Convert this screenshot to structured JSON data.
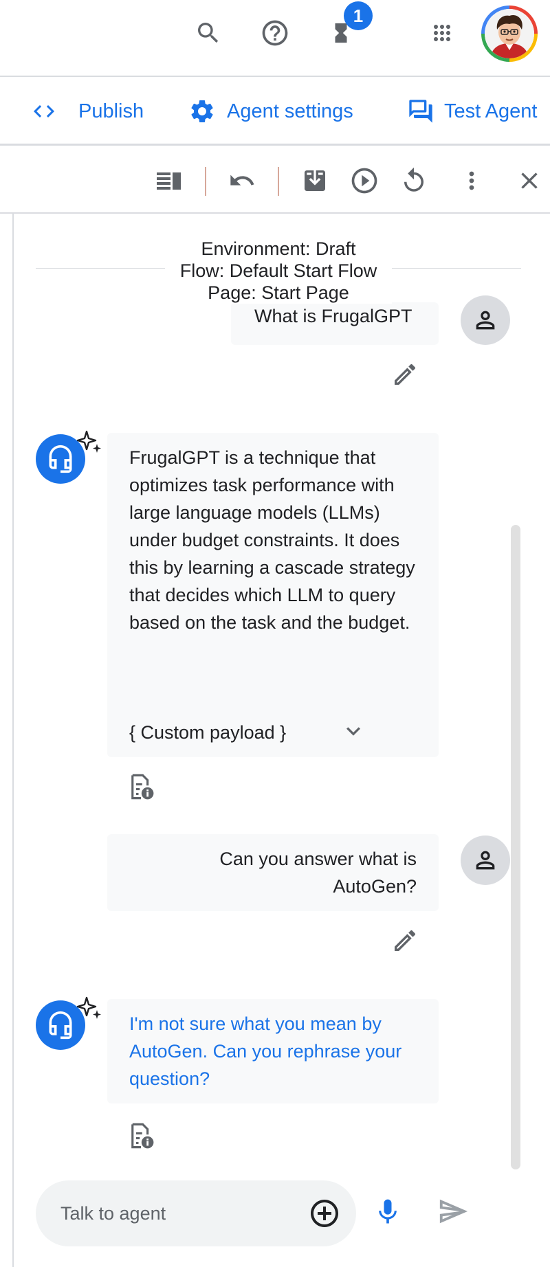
{
  "topbar": {
    "notification_count": "1",
    "icons": [
      "search-icon",
      "help-icon",
      "hourglass-icon",
      "apps-grid-icon",
      "account-avatar"
    ]
  },
  "actions": {
    "code_icon": "code-icon",
    "publish_label": "Publish",
    "agent_settings_label": "Agent settings",
    "test_agent_label": "Test Agent"
  },
  "simulator_toolbar": {
    "icons": [
      "panel-icon",
      "undo-icon",
      "export-icon",
      "play-icon",
      "reset-icon",
      "more-vert-icon",
      "close-icon"
    ]
  },
  "environment": {
    "line1": "Environment: Draft",
    "line2": "Flow: Default Start Flow",
    "line3": "Page: Start Page"
  },
  "conversation": {
    "user_msg_1": "What is FrugalGPT",
    "bot_msg_1": "FrugalGPT is a technique that optimizes task performance with large language models (LLMs) under budget constraints. It does this by learning a cascade strategy that decides which LLM to query based on the task and the budget.",
    "bot_msg_1_payload": "{ Custom payload }",
    "user_msg_2": "Can you answer what is AutoGen?",
    "bot_msg_2": "I'm not sure what you mean by AutoGen. Can you rephrase your question?"
  },
  "input": {
    "placeholder": "Talk to agent"
  },
  "colors": {
    "accent": "#1a73e8",
    "bubble_bg": "#f8f9fa",
    "divider": "#dadce0"
  }
}
